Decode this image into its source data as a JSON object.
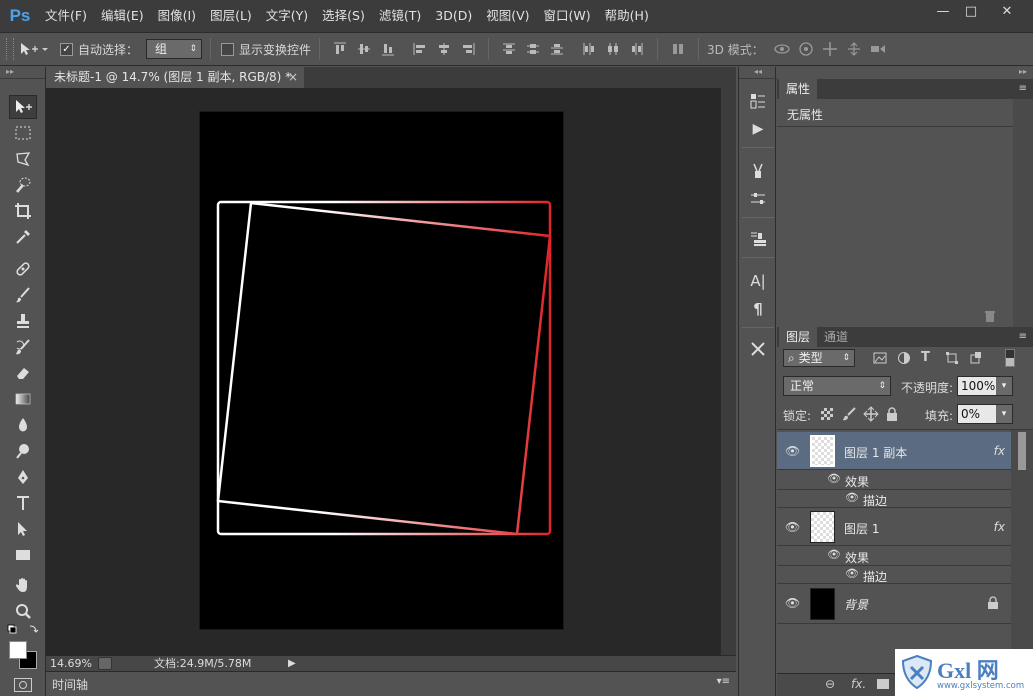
{
  "app": {
    "logo": "Ps"
  },
  "menu": [
    "文件(F)",
    "编辑(E)",
    "图像(I)",
    "图层(L)",
    "文字(Y)",
    "选择(S)",
    "滤镜(T)",
    "3D(D)",
    "视图(V)",
    "窗口(W)",
    "帮助(H)"
  ],
  "window_controls": {
    "minimize": "—",
    "maximize": "□",
    "close": "✕"
  },
  "options": {
    "auto_select_label": "自动选择：",
    "auto_select_value": "组",
    "show_transform_label": "显示变换控件",
    "mode_3d_label": "3D 模式："
  },
  "document": {
    "tab_title": "未标题-1 @ 14.7% (图层 1 副本, RGB/8) *",
    "tab_close": "×",
    "zoom": "14.69%",
    "doc_info": "文档:24.9M/5.78M"
  },
  "timeline": {
    "label": "时间轴"
  },
  "properties": {
    "tab": "属性",
    "empty_text": "无属性"
  },
  "layers_panel": {
    "tabs": [
      "图层",
      "通道"
    ],
    "filter_kind": "类型",
    "blend_mode": "正常",
    "opacity_label": "不透明度:",
    "opacity_value": "100%",
    "lock_label": "锁定:",
    "fill_label": "填充:",
    "fill_value": "0%",
    "layers": [
      {
        "name": "图层 1 副本",
        "fx": "fx",
        "effects_label": "效果",
        "effect": "描边"
      },
      {
        "name": "图层 1",
        "fx": "fx",
        "effects_label": "效果",
        "effect": "描边"
      },
      {
        "name": "背景"
      }
    ]
  },
  "watermark": {
    "brand": "Gxl 网",
    "url": "www.gxlsystem.com"
  },
  "colors": {
    "accent": "#4aa3f0",
    "selected_layer": "#5a6b82",
    "stroke_red": "#e0242a"
  }
}
